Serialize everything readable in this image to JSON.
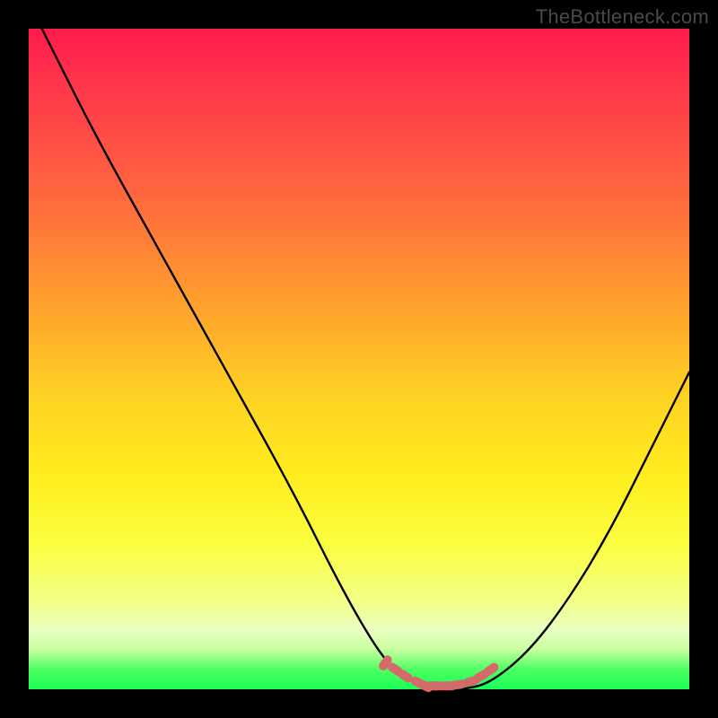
{
  "watermark": "TheBottleneck.com",
  "colors": {
    "background": "#000000",
    "gradient_top": "#ff1a4d",
    "gradient_mid": "#ffee1e",
    "gradient_bottom": "#1aff5a",
    "curve": "#000000",
    "markers": "#d46a6a"
  },
  "chart_data": {
    "type": "line",
    "title": "",
    "xlabel": "",
    "ylabel": "",
    "xlim": [
      0,
      100
    ],
    "ylim": [
      0,
      100
    ],
    "grid": false,
    "legend": false,
    "series": [
      {
        "name": "bottleneck-curve",
        "x": [
          2,
          10,
          20,
          30,
          40,
          48,
          54,
          58,
          62,
          66,
          70,
          76,
          82,
          88,
          94,
          100
        ],
        "y": [
          100,
          84,
          66,
          48,
          30,
          14,
          4,
          1,
          0,
          0,
          1,
          6,
          14,
          24,
          36,
          48
        ]
      }
    ],
    "markers": {
      "name": "highlight-segments",
      "x": [
        54,
        55.5,
        57,
        59,
        60,
        61,
        62,
        63.5,
        65,
        67,
        68.5,
        70
      ],
      "y": [
        4,
        3,
        2,
        1,
        0.5,
        0.5,
        0.5,
        0.5,
        0.7,
        1.2,
        2,
        3
      ]
    }
  }
}
